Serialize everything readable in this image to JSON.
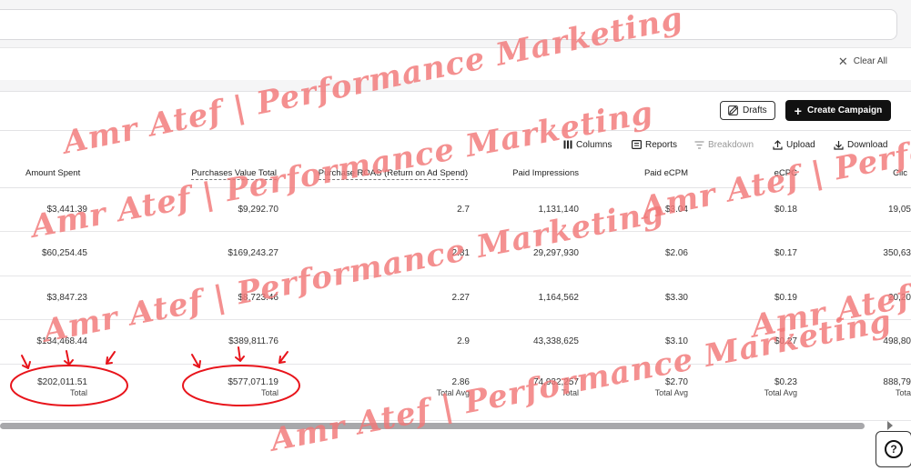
{
  "filters": {
    "clear_all_label": "Clear All"
  },
  "actions": {
    "drafts_label": "Drafts",
    "create_label": "Create Campaign"
  },
  "toolbar": {
    "columns_label": "Columns",
    "reports_label": "Reports",
    "breakdown_label": "Breakdown",
    "upload_label": "Upload",
    "download_label": "Download"
  },
  "table": {
    "headers": {
      "amount_spent": "Amount Spent",
      "purchases_value_total": "Purchases Value Total",
      "purchase_roas": "Purchase ROAS (Return on Ad Spend)",
      "paid_impressions": "Paid Impressions",
      "paid_ecpm": "Paid eCPM",
      "ecpc": "eCPC",
      "clicks": "Clic"
    },
    "rows": [
      {
        "amount_spent": "$3,441.39",
        "purchases_value_total": "$9,292.70",
        "roas": "2.7",
        "impressions": "1,131,140",
        "ecpm": "$3.04",
        "ecpc": "$0.18",
        "clicks": "19,05"
      },
      {
        "amount_spent": "$60,254.45",
        "purchases_value_total": "$169,243.27",
        "roas": "2.81",
        "impressions": "29,297,930",
        "ecpm": "$2.06",
        "ecpc": "$0.17",
        "clicks": "350,63"
      },
      {
        "amount_spent": "$3,847.23",
        "purchases_value_total": "$8,723.46",
        "roas": "2.27",
        "impressions": "1,164,562",
        "ecpm": "$3.30",
        "ecpc": "$0.19",
        "clicks": "20,20"
      },
      {
        "amount_spent": "$134,468.44",
        "purchases_value_total": "$389,811.76",
        "roas": "2.9",
        "impressions": "43,338,625",
        "ecpm": "$3.10",
        "ecpc": "$0.27",
        "clicks": "498,80"
      }
    ],
    "totals": {
      "amount_spent": "$202,011.51",
      "amount_spent_label": "Total",
      "purchases_value_total": "$577,071.19",
      "purchases_value_label": "Total",
      "roas": "2.86",
      "roas_label": "Total Avg",
      "impressions": "74,932,257",
      "impressions_label": "Total",
      "ecpm": "$2.70",
      "ecpm_label": "Total Avg",
      "ecpc": "$0.23",
      "ecpc_label": "Total Avg",
      "clicks": "888,79",
      "clicks_label": "Tota"
    }
  },
  "watermark": {
    "text": "Amr Atef | Performance Marketing",
    "fragment": "Amr Atef | Perfo",
    "fragment2": "Amr Atef",
    "color": "#f27878"
  },
  "annotation_color": "#e8141b"
}
